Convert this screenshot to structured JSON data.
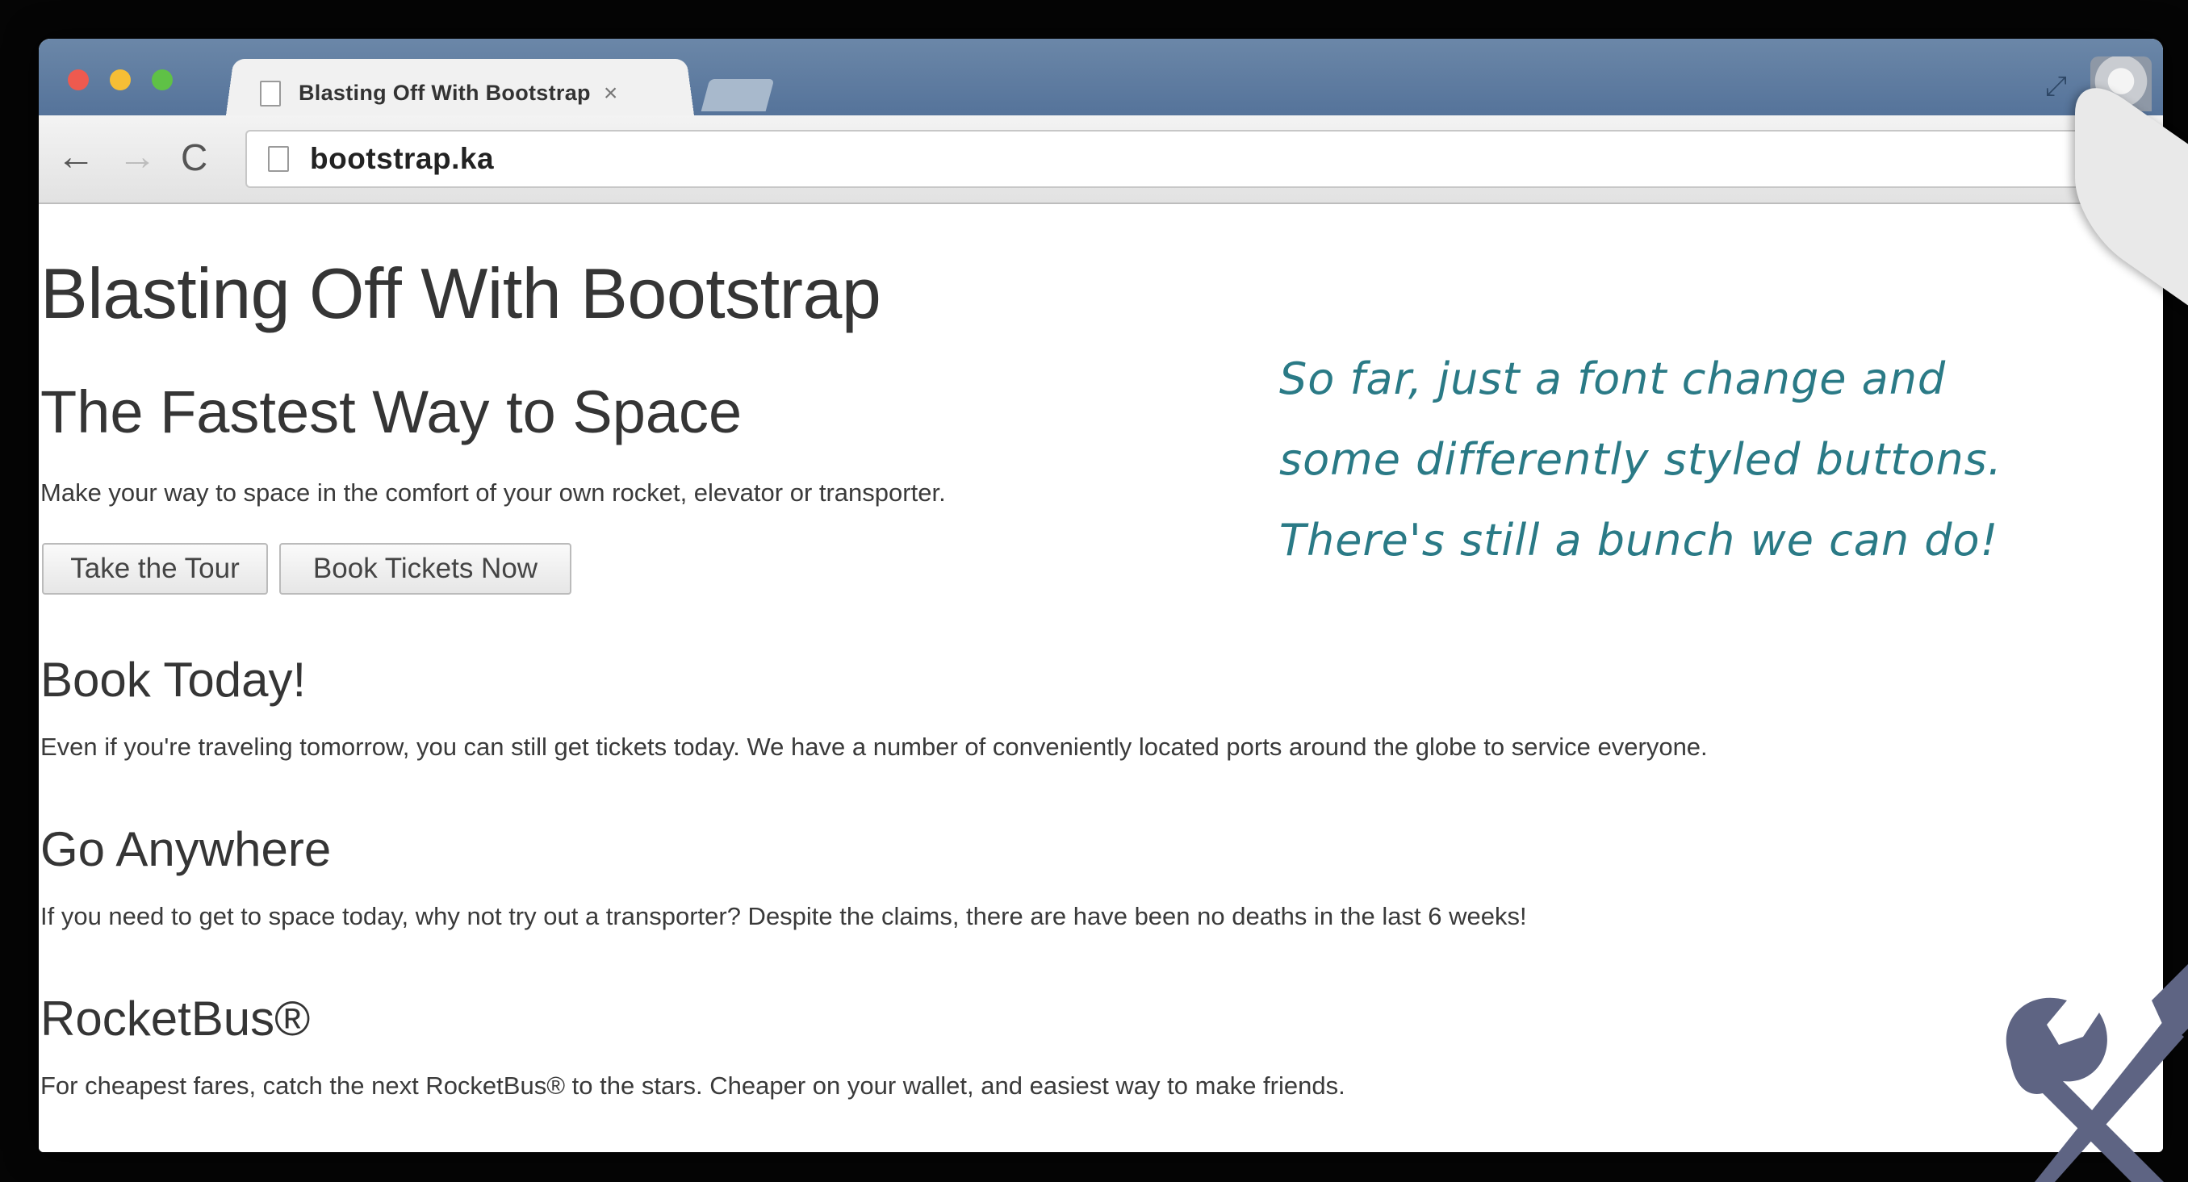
{
  "browser": {
    "tab_title": "Blasting Off With Bootstrap",
    "tab_close": "×",
    "url": "bootstrap.ka",
    "back_glyph": "←",
    "forward_glyph": "→",
    "reload_glyph": "C",
    "resize_glyph": "⤢"
  },
  "page": {
    "title": "Blasting Off With Bootstrap",
    "subtitle": "The Fastest Way to Space",
    "lead": "Make your way to space in the comfort of your own rocket, elevator or transporter.",
    "buttons": {
      "tour": "Take the Tour",
      "book": "Book Tickets Now"
    },
    "sections": [
      {
        "heading": "Book Today!",
        "text": "Even if you're traveling tomorrow, you can still get tickets today. We have a number of conveniently located ports around the globe to service everyone."
      },
      {
        "heading": "Go Anywhere",
        "text": "If you need to get to space today, why not try out a transporter? Despite the claims, there are have been no deaths in the last 6 weeks!"
      },
      {
        "heading": "RocketBus®",
        "text": "For cheapest fares, catch the next RocketBus® to the stars. Cheaper on your wallet, and easiest way to make friends."
      }
    ]
  },
  "annotation": {
    "lines": [
      "So far, just a font change and",
      "some differently styled buttons.",
      "There's still a bunch we can do!"
    ]
  },
  "colors": {
    "titlebar": "#5f7da2",
    "annotation": "#2a7a86",
    "tools": "#5e6483"
  },
  "icons": {
    "tools": "wrench-screwdriver-icon"
  }
}
